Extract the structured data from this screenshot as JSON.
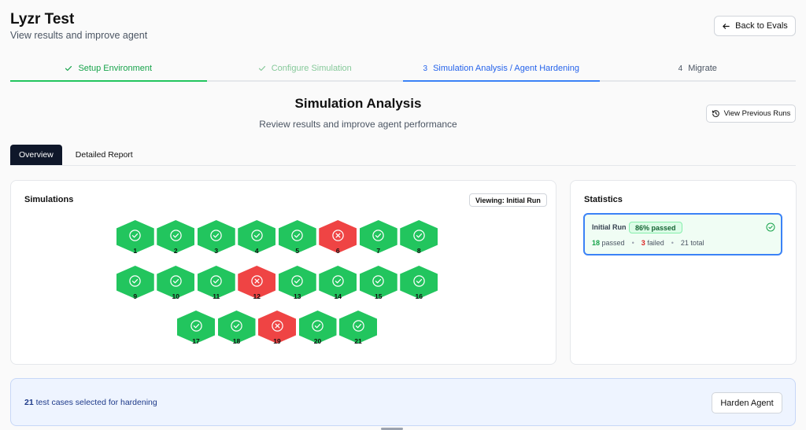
{
  "header": {
    "title": "Lyzr Test",
    "subtitle": "View results and improve agent",
    "back_label": "Back to Evals"
  },
  "steps": [
    {
      "num": "",
      "label": "Setup Environment",
      "state": "done"
    },
    {
      "num": "",
      "label": "Configure Simulation",
      "state": "done-light"
    },
    {
      "num": "3",
      "label": "Simulation Analysis / Agent Hardening",
      "state": "active"
    },
    {
      "num": "4",
      "label": "Migrate",
      "state": "todo"
    }
  ],
  "section": {
    "title": "Simulation Analysis",
    "subtitle": "Review results and improve agent performance",
    "prev_runs_label": "View Previous Runs"
  },
  "tabs": [
    {
      "label": "Overview",
      "active": true
    },
    {
      "label": "Detailed Report",
      "active": false
    }
  ],
  "simulations": {
    "title": "Simulations",
    "viewing_label": "Viewing: Initial Run",
    "rows": [
      [
        {
          "n": "1",
          "s": "pass"
        },
        {
          "n": "2",
          "s": "pass"
        },
        {
          "n": "3",
          "s": "pass"
        },
        {
          "n": "4",
          "s": "pass"
        },
        {
          "n": "5",
          "s": "pass"
        },
        {
          "n": "6",
          "s": "fail"
        },
        {
          "n": "7",
          "s": "pass"
        },
        {
          "n": "8",
          "s": "pass"
        }
      ],
      [
        {
          "n": "9",
          "s": "pass"
        },
        {
          "n": "10",
          "s": "pass"
        },
        {
          "n": "11",
          "s": "pass"
        },
        {
          "n": "12",
          "s": "fail"
        },
        {
          "n": "13",
          "s": "pass"
        },
        {
          "n": "14",
          "s": "pass"
        },
        {
          "n": "15",
          "s": "pass"
        },
        {
          "n": "16",
          "s": "pass"
        }
      ],
      [
        {
          "n": "17",
          "s": "pass"
        },
        {
          "n": "18",
          "s": "pass"
        },
        {
          "n": "19",
          "s": "fail"
        },
        {
          "n": "20",
          "s": "pass"
        },
        {
          "n": "21",
          "s": "pass"
        }
      ]
    ]
  },
  "statistics": {
    "title": "Statistics",
    "run_name": "Initial Run",
    "badge": "86% passed",
    "passed_count": "18",
    "passed_label": "passed",
    "failed_count": "3",
    "failed_label": "failed",
    "total": "21 total"
  },
  "footer": {
    "count": "21",
    "text": "test cases selected for hardening",
    "harden_label": "Harden Agent"
  },
  "colors": {
    "pass": "#22c55e",
    "fail": "#ef4444",
    "active_step": "#2563eb",
    "done_step": "#16a34a"
  }
}
